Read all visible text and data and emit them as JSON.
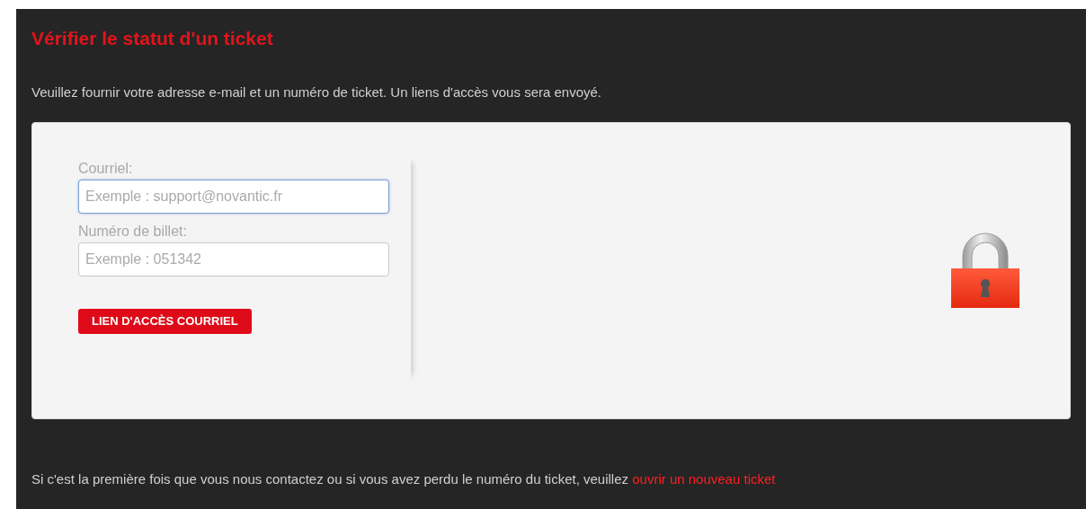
{
  "title": "Vérifier le statut d'un ticket",
  "intro": "Veuillez fournir votre adresse e-mail et un numéro de ticket. Un liens d'accès vous sera envoyé.",
  "fields": [
    {
      "label": "Courriel:",
      "placeholder": "Exemple : support@novantic.fr",
      "focused": true
    },
    {
      "label": "Numéro de billet:",
      "placeholder": "Exemple : 051342",
      "focused": false
    }
  ],
  "submit_button": "LIEN D'ACCÈS COURRIEL",
  "footer": {
    "text": "Si c'est la première fois que vous nous contactez ou si vous avez perdu le numéro du ticket, veuillez",
    "link": "ouvrir un nouveau ticket"
  }
}
